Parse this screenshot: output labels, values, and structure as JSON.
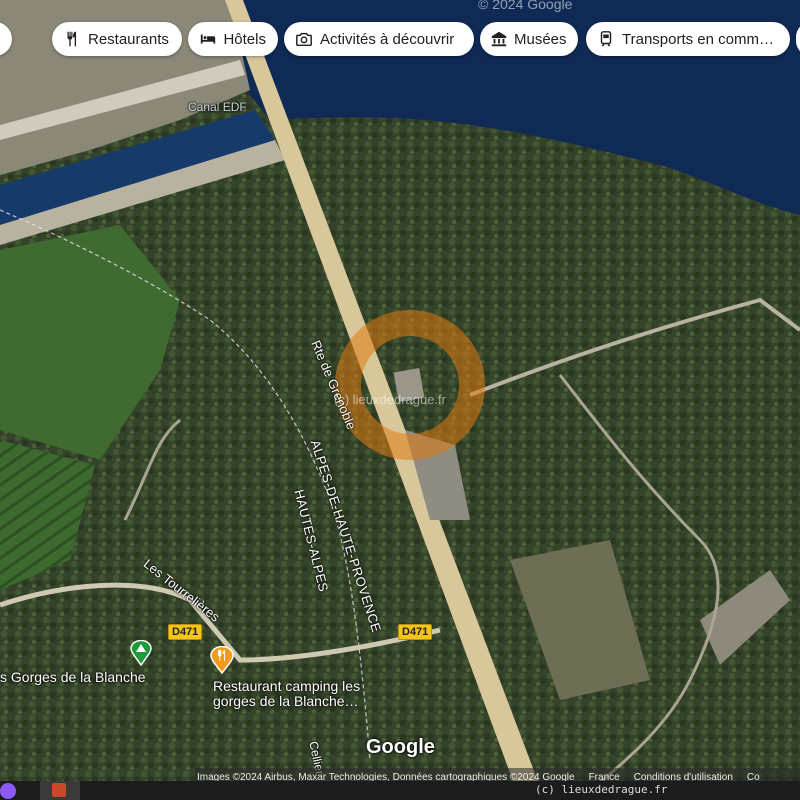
{
  "chips": [
    {
      "label": "Restaurants",
      "icon": "fork-knife-icon"
    },
    {
      "label": "Hôtels",
      "icon": "bed-icon"
    },
    {
      "label": "Activités à découvrir",
      "icon": "camera-icon"
    },
    {
      "label": "Musées",
      "icon": "museum-icon"
    },
    {
      "label": "Transports en comm…",
      "icon": "train-icon"
    }
  ],
  "map_labels": {
    "canal": "Canal EDF",
    "route": "Rte de Grenoble",
    "dept_1": "ALPES-DE-HAUTE-PROVENCE",
    "dept_2": "HAUTES-ALPES",
    "road_1": "Les Tourrelières",
    "road_2": "Cellier",
    "shield_1": "D471",
    "shield_2": "D471",
    "watermark_center": "(c) lieuxdedrague.fr",
    "watermark_top": "© 2024 Google"
  },
  "pois": {
    "camping": "s Gorges de la Blanche",
    "restaurant_line1": "Restaurant camping les",
    "restaurant_line2": "gorges de la Blanche…"
  },
  "logo": "Google",
  "bottom_bar": {
    "attribution": "Images ©2024 Airbus, Maxar Technologies, Données cartographiques ©2024 Google",
    "country": "France",
    "terms": "Conditions d'utilisation",
    "extra": "Co",
    "watermark": "(c) lieuxdedrague.fr"
  },
  "colors": {
    "water": "#0f2a55",
    "forest": "#3a4a2c",
    "road": "#d8c79a",
    "marker_ring": "#e07a10",
    "camping_pin": "#1e9a3a",
    "restaurant_pin": "#f29a1a"
  }
}
